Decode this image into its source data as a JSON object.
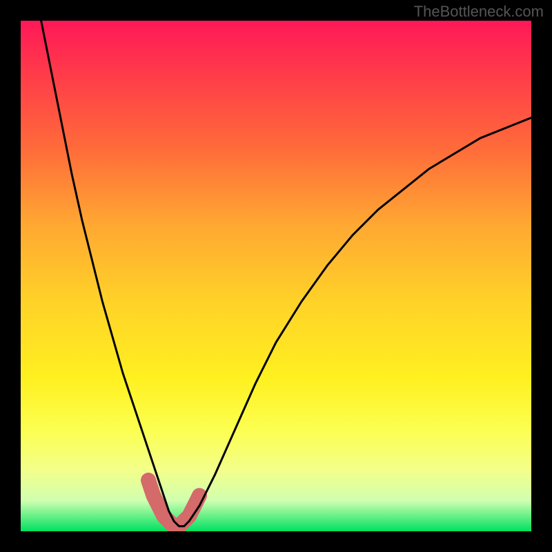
{
  "watermark": "TheBottleneck.com",
  "chart_data": {
    "type": "line",
    "title": "",
    "xlabel": "",
    "ylabel": "",
    "xlim": [
      0,
      100
    ],
    "ylim": [
      0,
      100
    ],
    "series": [
      {
        "name": "curve",
        "x": [
          4,
          6,
          8,
          10,
          12,
          14,
          16,
          18,
          20,
          22,
          24,
          26,
          27,
          28,
          29,
          30,
          31,
          32,
          33,
          35,
          38,
          42,
          46,
          50,
          55,
          60,
          65,
          70,
          75,
          80,
          85,
          90,
          95,
          100
        ],
        "values": [
          100,
          90,
          80,
          70,
          61,
          53,
          45,
          38,
          31,
          25,
          19,
          13,
          10,
          7,
          4,
          2,
          1,
          1,
          2,
          5,
          11,
          20,
          29,
          37,
          45,
          52,
          58,
          63,
          67,
          71,
          74,
          77,
          79,
          81
        ]
      },
      {
        "name": "highlight",
        "x": [
          25,
          26,
          27,
          28,
          29,
          30,
          31,
          32,
          33,
          34,
          35
        ],
        "values": [
          10,
          7,
          5,
          3,
          2,
          1,
          1,
          2,
          3,
          5,
          7
        ]
      }
    ],
    "gradient_stops": [
      {
        "pos": 0,
        "color": "#ff1858"
      },
      {
        "pos": 25,
        "color": "#ff6b3a"
      },
      {
        "pos": 55,
        "color": "#ffd228"
      },
      {
        "pos": 80,
        "color": "#fcff50"
      },
      {
        "pos": 100,
        "color": "#00e060"
      }
    ]
  }
}
